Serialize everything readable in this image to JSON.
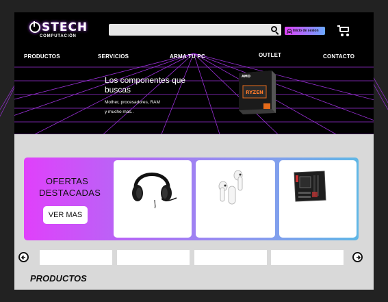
{
  "brand": {
    "name": "STECH",
    "subtitle": "COMPUTACIÓN"
  },
  "search": {
    "placeholder": "",
    "icon": "search-icon"
  },
  "header": {
    "login_label": "Inicio de sesion",
    "cart_icon": "cart-icon"
  },
  "nav": {
    "items": [
      {
        "label": "PRODUCTOS"
      },
      {
        "label": "SERVICIOS"
      },
      {
        "label": "ARMA TU PC"
      },
      {
        "label": "OUTLET"
      },
      {
        "label": "CONTACTO"
      }
    ]
  },
  "hero": {
    "title": "Los componentes que buscas",
    "line1": "Mother, procesadores, RAM",
    "line2": "y mucho mas..",
    "box_brand": "AMD",
    "box_label": "RYZEN"
  },
  "ofertas": {
    "title": "OFERTAS DESTACADAS",
    "button_label": "VER MAS",
    "products": [
      {
        "name": "headphones"
      },
      {
        "name": "earbuds"
      },
      {
        "name": "motherboard"
      }
    ]
  },
  "carousel": {
    "prev_icon": "arrow-left-icon",
    "next_icon": "arrow-right-icon"
  },
  "productos": {
    "title": "PRODUCTOS"
  },
  "colors": {
    "page_bg": "#222222",
    "header_bg": "#000000",
    "accent_pink": "#e040fb",
    "accent_blue": "#5fb7e6",
    "grey_section": "#d9d9d9"
  }
}
